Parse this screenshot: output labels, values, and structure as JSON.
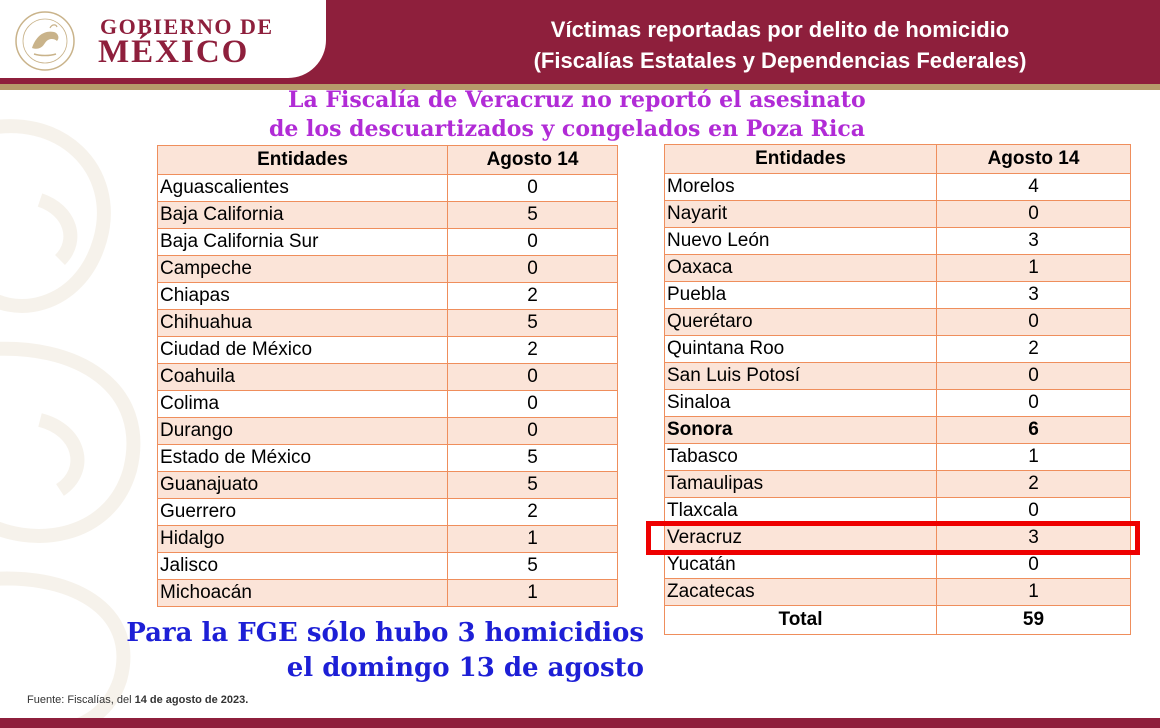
{
  "header": {
    "logo_line1": "GOBIERNO DE",
    "logo_line2": "MÉXICO",
    "title_line1": "Víctimas reportadas por delito de homicidio",
    "title_line2": "(Fiscalías Estatales y Dependencias Federales)",
    "brand_color": "#8e1f3c",
    "accent_color": "#b69b6b"
  },
  "annotation_top": {
    "line1": "La Fiscalía de Veracruz no reportó el asesinato",
    "line2": "de los descuartizados y congelados en Poza Rica",
    "color": "#b12bd6"
  },
  "left_table": {
    "col1": "Entidades",
    "col2": "Agosto 14",
    "rows": [
      {
        "entidad": "Aguascalientes",
        "valor": "0"
      },
      {
        "entidad": "Baja California",
        "valor": "5"
      },
      {
        "entidad": "Baja California Sur",
        "valor": "0"
      },
      {
        "entidad": "Campeche",
        "valor": "0"
      },
      {
        "entidad": "Chiapas",
        "valor": "2"
      },
      {
        "entidad": "Chihuahua",
        "valor": "5"
      },
      {
        "entidad": "Ciudad de México",
        "valor": "2"
      },
      {
        "entidad": "Coahuila",
        "valor": "0"
      },
      {
        "entidad": "Colima",
        "valor": "0"
      },
      {
        "entidad": "Durango",
        "valor": "0"
      },
      {
        "entidad": "Estado de México",
        "valor": "5"
      },
      {
        "entidad": "Guanajuato",
        "valor": "5"
      },
      {
        "entidad": "Guerrero",
        "valor": "2"
      },
      {
        "entidad": "Hidalgo",
        "valor": "1"
      },
      {
        "entidad": "Jalisco",
        "valor": "5"
      },
      {
        "entidad": "Michoacán",
        "valor": "1"
      }
    ]
  },
  "right_table": {
    "col1": "Entidades",
    "col2": "Agosto 14",
    "rows": [
      {
        "entidad": "Morelos",
        "valor": "4"
      },
      {
        "entidad": "Nayarit",
        "valor": "0"
      },
      {
        "entidad": "Nuevo León",
        "valor": "3"
      },
      {
        "entidad": "Oaxaca",
        "valor": "1"
      },
      {
        "entidad": "Puebla",
        "valor": "3"
      },
      {
        "entidad": "Querétaro",
        "valor": "0"
      },
      {
        "entidad": "Quintana Roo",
        "valor": "2"
      },
      {
        "entidad": "San Luis Potosí",
        "valor": "0"
      },
      {
        "entidad": "Sinaloa",
        "valor": "0"
      },
      {
        "entidad": "Sonora",
        "valor": "6"
      },
      {
        "entidad": "Tabasco",
        "valor": "1"
      },
      {
        "entidad": "Tamaulipas",
        "valor": "2"
      },
      {
        "entidad": "Tlaxcala",
        "valor": "0"
      },
      {
        "entidad": "Veracruz",
        "valor": "3"
      },
      {
        "entidad": "Yucatán",
        "valor": "0"
      },
      {
        "entidad": "Zacatecas",
        "valor": "1"
      }
    ],
    "total_label": "Total",
    "total_value": "59",
    "highlight_color": "#ee0000"
  },
  "annotation_bottom": {
    "line1": "Para la FGE sólo hubo 3 homicidios",
    "line2": "el domingo 13 de agosto",
    "color": "#1d1fd6"
  },
  "source": {
    "prefix": "Fuente: Fiscalías, del ",
    "date": "14 de agosto de 2023."
  }
}
